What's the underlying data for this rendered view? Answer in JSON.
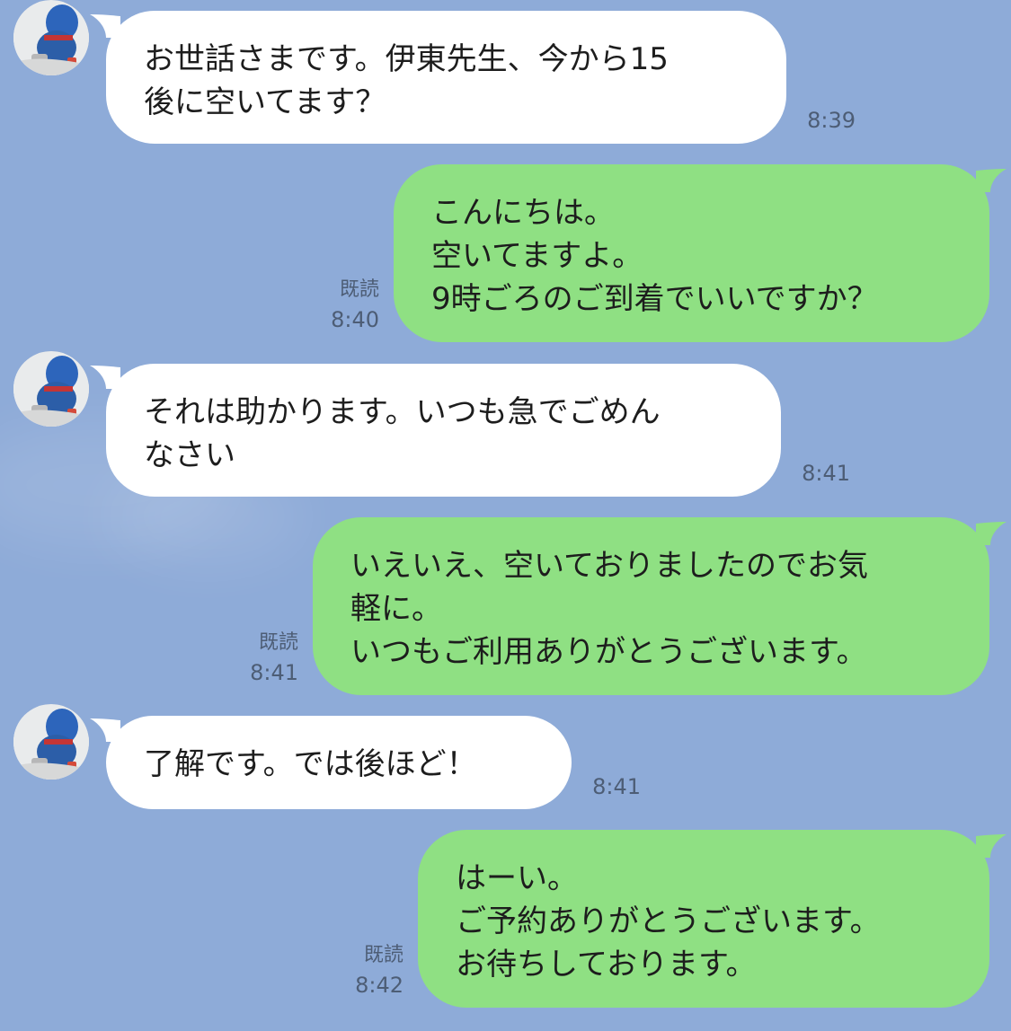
{
  "chat": {
    "messages": [
      {
        "direction": "incoming",
        "text": "お世話さまです。伊東先生、今から15\n後に空いてます？",
        "time": "8:39"
      },
      {
        "direction": "outgoing",
        "text": "こんにちは。\n空いてますよ。\n9時ごろのご到着でいいですか？",
        "read": "既読",
        "time": "8:40"
      },
      {
        "direction": "incoming",
        "text": "それは助かります。いつも急でごめん\nなさい",
        "time": "8:41"
      },
      {
        "direction": "outgoing",
        "text": "いえいえ、空いておりましたのでお気\n軽に。\nいつもご利用ありがとうございます。",
        "read": "既読",
        "time": "8:41"
      },
      {
        "direction": "incoming",
        "text": "了解です。では後ほど！",
        "time": "8:41"
      },
      {
        "direction": "outgoing",
        "text": "はーい。\nご予約ありがとうございます。\nお待ちしております。",
        "read": "既読",
        "time": "8:42"
      }
    ],
    "colors": {
      "background": "#8eabd8",
      "incoming_bubble": "#ffffff",
      "outgoing_bubble": "#8fe083",
      "meta_text": "#4d5d75"
    },
    "icons": {
      "avatar": "doraemon-avatar",
      "tail": "bubble-tail"
    }
  }
}
